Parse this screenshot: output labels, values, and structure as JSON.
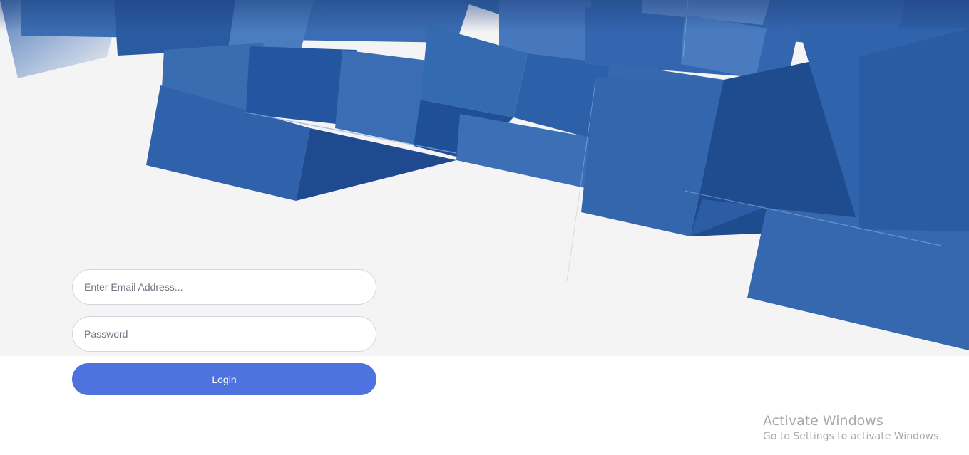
{
  "login_form": {
    "email_placeholder": "Enter Email Address...",
    "password_placeholder": "Password",
    "login_label": "Login"
  },
  "watermark": {
    "title": "Activate Windows",
    "subtitle": "Go to Settings to activate Windows."
  },
  "colors": {
    "background": "#f4f4f5",
    "accent": "#4e73df",
    "cube_blue": "#2f62aa"
  }
}
